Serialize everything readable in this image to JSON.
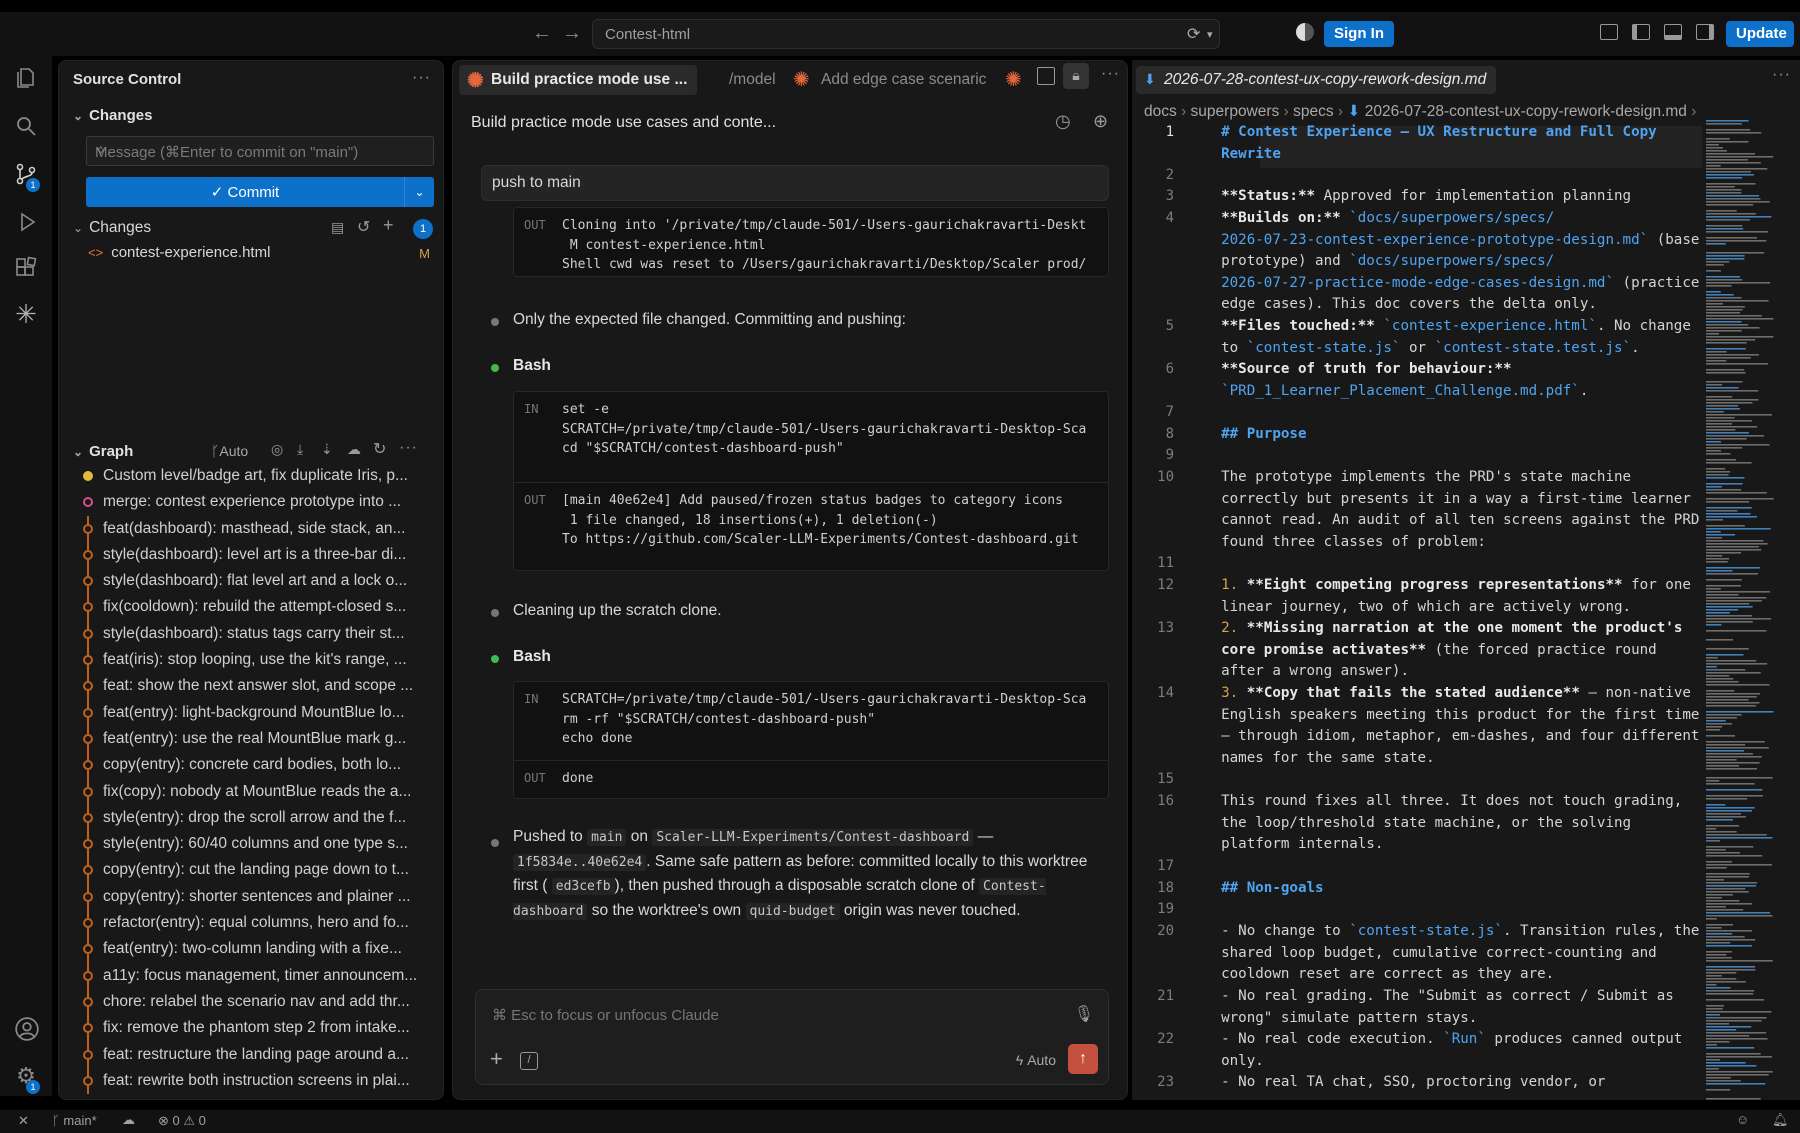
{
  "titlebar": {
    "search_text": "Contest-html",
    "signin_label": "Sign In",
    "update_label": "Update"
  },
  "activity": {
    "scm_badge": "1",
    "settings_badge": "1"
  },
  "scm": {
    "title": "Source Control",
    "changes_section": "Changes",
    "message_placeholder": "Message (⌘Enter to commit on \"main\")",
    "commit_label": "Commit",
    "changes_group": "Changes",
    "changes_count": "1",
    "file_name": "contest-experience.html",
    "file_status": "M",
    "graph_title": "Graph",
    "graph_auto": "Auto",
    "commits": [
      "Custom level/badge art, fix duplicate Iris, p...",
      "merge: contest experience prototype into ...",
      "feat(dashboard): masthead, side stack, an...",
      "style(dashboard): level art is a three-bar di...",
      "style(dashboard): flat level art and a lock o...",
      "fix(cooldown): rebuild the attempt-closed s...",
      "style(dashboard): status tags carry their st...",
      "feat(iris): stop looping, use the kit's range, ...",
      "feat: show the next answer slot, and scope ...",
      "feat(entry): light-background MountBlue lo...",
      "feat(entry): use the real MountBlue mark  g...",
      "copy(entry): concrete card bodies, both lo...",
      "fix(copy): nobody at MountBlue reads the a...",
      "style(entry): drop the scroll arrow and the f...",
      "style(entry): 60/40 columns and one type s...",
      "copy(entry): cut the landing page down to t...",
      "copy(entry): shorter sentences and plainer ...",
      "refactor(entry): equal columns, hero and fo...",
      "feat(entry): two-column landing with a fixe...",
      "a11y: focus management, timer announcem...",
      "chore: relabel the scenario nav and add thr...",
      "fix: remove the phantom step 2 from intake...",
      "feat: restructure the landing page around a...",
      "feat: rewrite both instruction screens in plai..."
    ]
  },
  "chat": {
    "tab_active": "Build practice mode use ...",
    "tab_model": "/model",
    "tab_other": "Add edge case scenaric",
    "title": "Build practice mode use cases and conte...",
    "user_msg": "push to main",
    "out_label": "OUT",
    "in_label": "IN",
    "block1_out": "Cloning into '/private/tmp/claude-501/-Users-gaurichakravarti-Deskt\n M contest-experience.html\nShell cwd was reset to /Users/gaurichakravarti/Desktop/Scaler prod/",
    "msg1": "Only the expected file changed. Committing and pushing:",
    "bash1": "Bash",
    "bash1_in": "set -e\nSCRATCH=/private/tmp/claude-501/-Users-gaurichakravarti-Desktop-Sca\ncd \"$SCRATCH/contest-dashboard-push\"",
    "bash1_out": "[main 40e62e4] Add paused/frozen status badges to category icons\n 1 file changed, 18 insertions(+), 1 deletion(-)\nTo https://github.com/Scaler-LLM-Experiments/Contest-dashboard.git",
    "msg2": "Cleaning up the scratch clone.",
    "bash2": "Bash",
    "bash2_in": "SCRATCH=/private/tmp/claude-501/-Users-gaurichakravarti-Desktop-Sca\nrm -rf \"$SCRATCH/contest-dashboard-push\"\necho done",
    "bash2_out": "done",
    "final": {
      "p1": "Pushed to",
      "c1": "main",
      "p2": "on",
      "c2": "Scaler-LLM-Experiments/Contest-dashboard",
      "p3": "—",
      "c3": "1f5834e..40e62e4",
      "p4": ". Same safe pattern as before: committed locally to this worktree first (",
      "c4": "ed3cefb",
      "p5": "), then pushed through a disposable scratch clone of",
      "c5": "Contest-dashboard",
      "p6": "so the worktree's own",
      "c6": "quid-budget",
      "p7": "origin was never touched."
    },
    "input_placeholder": "⌘ Esc to focus or unfocus Claude",
    "auto_label": "Auto"
  },
  "editor": {
    "tab": "2026-07-28-contest-ux-copy-rework-design.md",
    "crumbs": [
      "docs",
      "superpowers",
      "specs",
      "2026-07-28-contest-ux-copy-rework-design.md"
    ]
  },
  "status": {
    "branch": "main*",
    "errors": "0",
    "warnings": "0"
  }
}
